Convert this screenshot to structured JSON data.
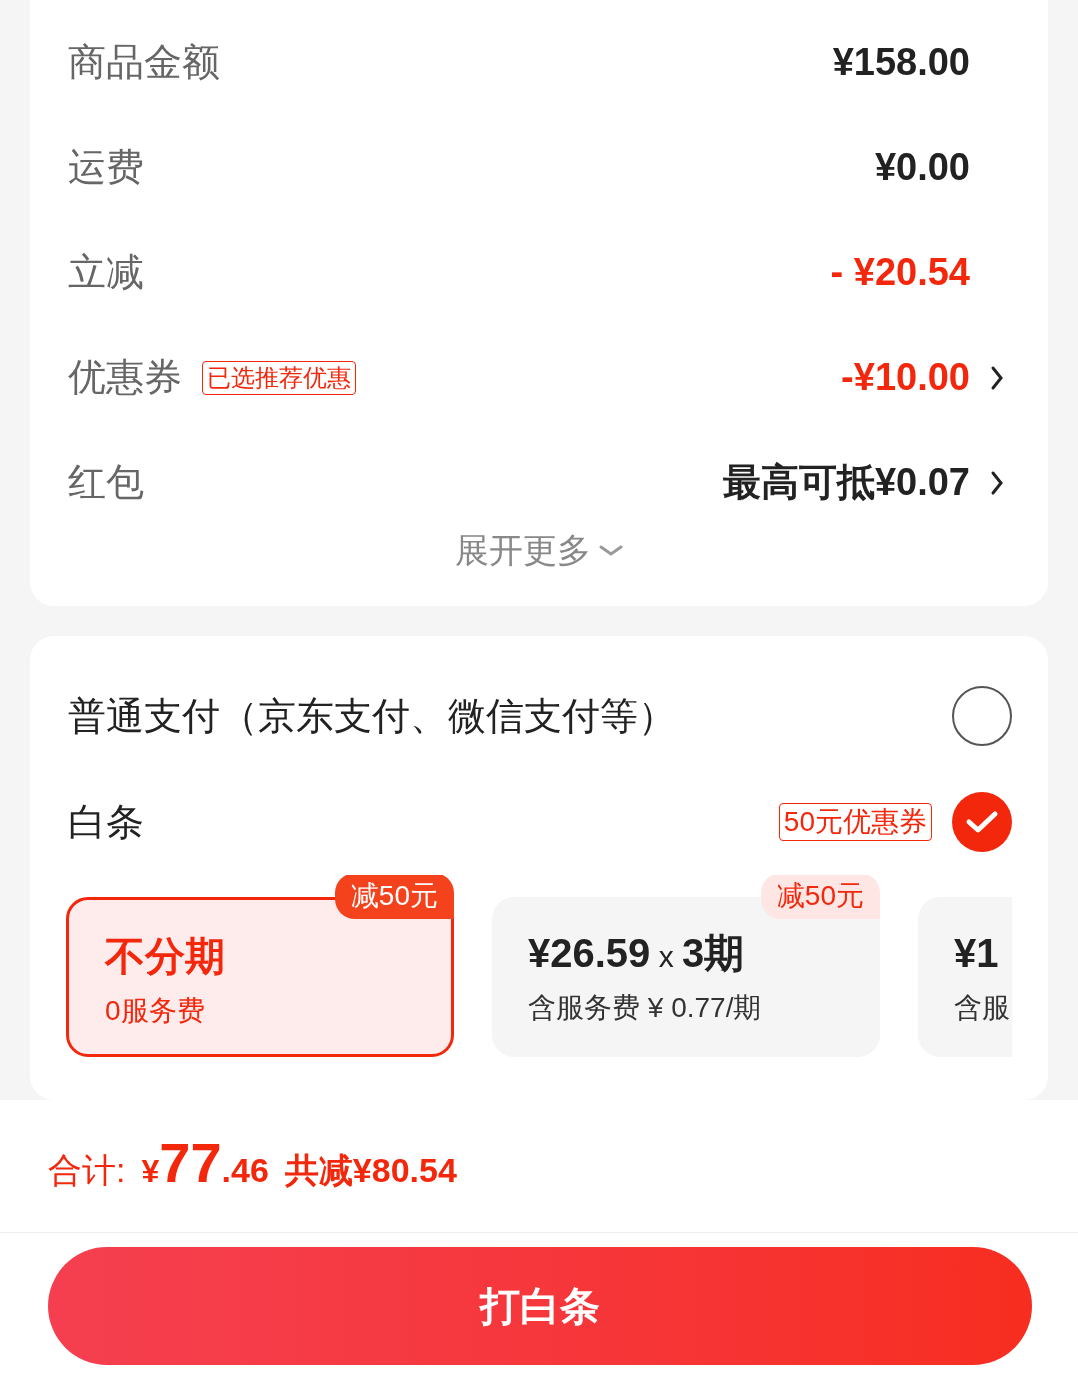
{
  "summary": {
    "rows": [
      {
        "kind": "amount",
        "label": "商品金额",
        "value": "¥158.00",
        "highlight": false
      },
      {
        "kind": "amount",
        "label": "运费",
        "value": "¥0.00",
        "highlight": false
      },
      {
        "kind": "amount",
        "label": "立减",
        "value": "- ¥20.54",
        "highlight": true
      },
      {
        "kind": "coupon",
        "label": "优惠券",
        "tag": "已选推荐优惠",
        "value": "-¥10.00",
        "highlight": true,
        "chevron": true
      },
      {
        "kind": "amount",
        "label": "红包",
        "value": "最高可抵¥0.07",
        "highlight": false,
        "chevron": true
      }
    ],
    "expand": "展开更多"
  },
  "payment": {
    "options": [
      {
        "label": "普通支付（京东支付、微信支付等）",
        "selected": false
      },
      {
        "label": "白条",
        "tag": "50元优惠券",
        "selected": true
      }
    ],
    "plans": [
      {
        "title": "不分期",
        "subtitle": "0服务费",
        "badge": "减50元",
        "selected": true
      },
      {
        "title": "¥26.59",
        "multiplier": "x",
        "periods": "3期",
        "subtitle": "含服务费 ¥ 0.77/期",
        "badge": "减50元",
        "selected": false
      },
      {
        "title": "¥1",
        "subtitle": "含服",
        "selected": false
      }
    ]
  },
  "total": {
    "label": "合计:",
    "currency": "¥",
    "integer": "77",
    "decimal": ".46",
    "saved": "共减¥80.54"
  },
  "submit": "打白条"
}
